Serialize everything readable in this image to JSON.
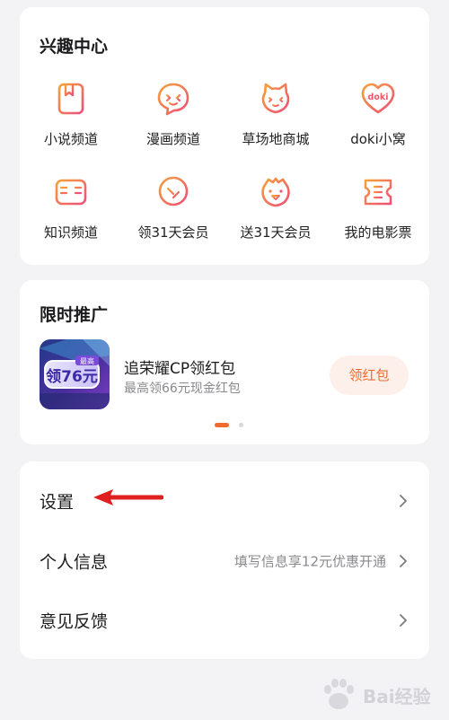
{
  "interest_center": {
    "title": "兴趣中心",
    "items": [
      {
        "label": "小说频道",
        "icon": "book-icon"
      },
      {
        "label": "漫画频道",
        "icon": "comic-face-icon"
      },
      {
        "label": "草场地商城",
        "icon": "cat-face-icon"
      },
      {
        "label": "doki小窝",
        "icon": "doki-heart-icon"
      },
      {
        "label": "知识频道",
        "icon": "open-book-icon"
      },
      {
        "label": "领31天会员",
        "icon": "tree-icon"
      },
      {
        "label": "送31天会员",
        "icon": "duck-face-icon"
      },
      {
        "label": "我的电影票",
        "icon": "ticket-icon"
      }
    ]
  },
  "promo": {
    "title": "限时推广",
    "thumb_text": "领76元",
    "item_title": "追荣耀CP领红包",
    "item_sub": "最高领66元现金红包",
    "button_label": "领红包"
  },
  "settings_list": {
    "rows": [
      {
        "label": "设置",
        "hint": ""
      },
      {
        "label": "个人信息",
        "hint": "填写信息享12元优惠开通"
      },
      {
        "label": "意见反馈",
        "hint": ""
      }
    ]
  },
  "watermark": {
    "text": "Bai经验"
  },
  "colors": {
    "accent": "#f06a2e",
    "icon_gradient_start": "#f7a03a",
    "icon_gradient_end": "#ef4f78",
    "background": "#f3f3f6",
    "annotation_arrow": "#e02020"
  }
}
